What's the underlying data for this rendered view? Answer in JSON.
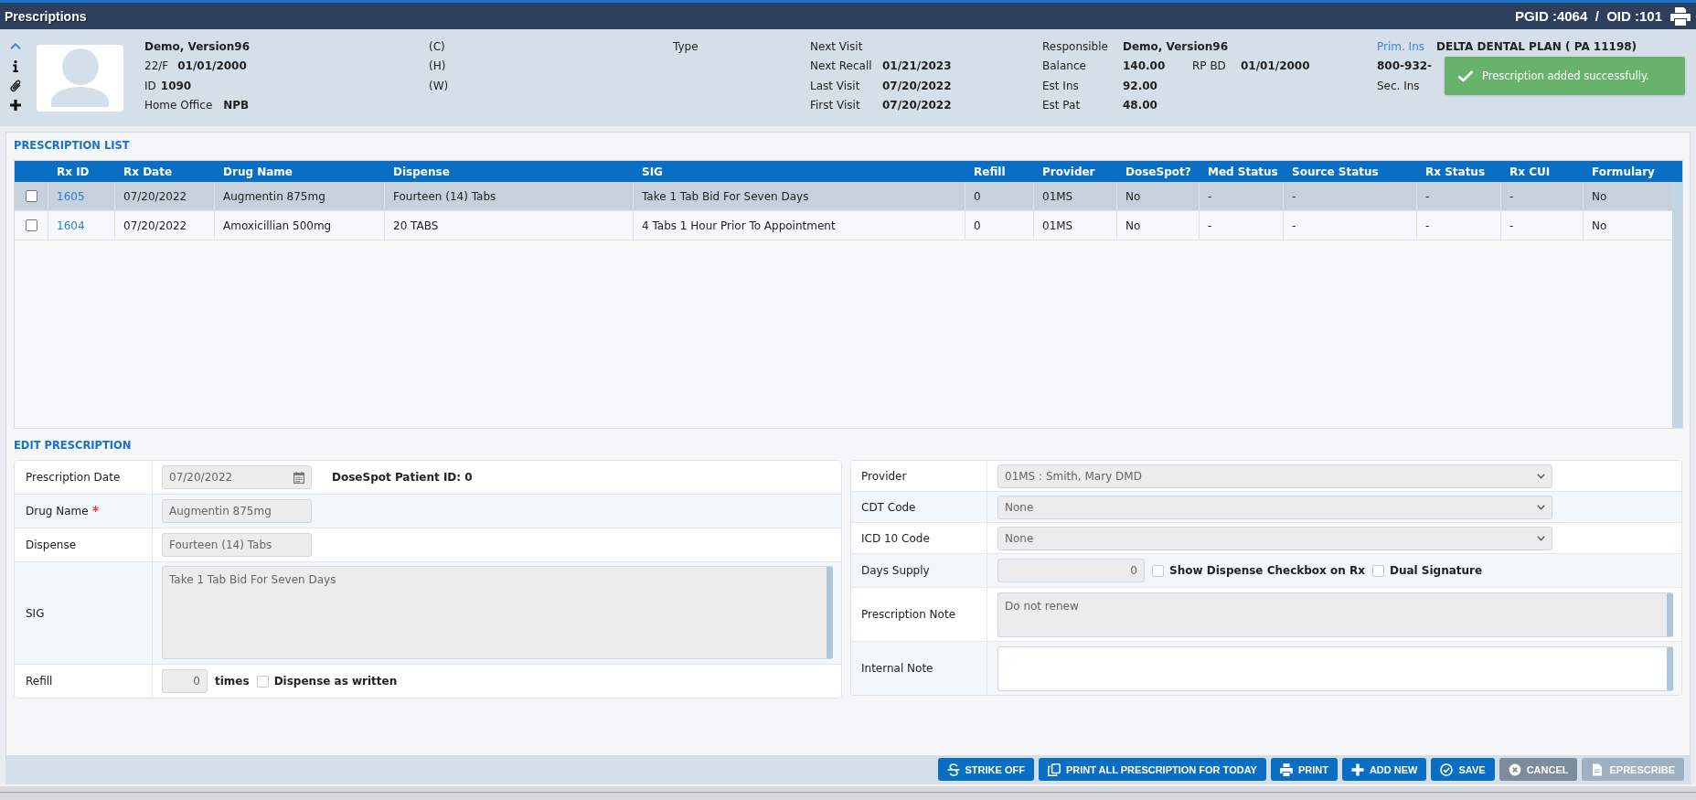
{
  "window": {
    "title": "Prescriptions",
    "ids": "PGID :4064  /  OID :101"
  },
  "patient": {
    "name": "Demo, Version96",
    "age_sex": "22/F",
    "birth_date": "01/01/2000",
    "id_label": "ID",
    "id": "1090",
    "office_label": "Home Office",
    "office": "NPB"
  },
  "phones": [
    "(C)",
    "(H)",
    "(W)"
  ],
  "type_label": "Type",
  "visits": [
    {
      "label": "Next Visit"
    },
    {
      "label": "Next Recall",
      "value": "01/21/2023"
    },
    {
      "label": "Last Visit",
      "value": "07/20/2022"
    },
    {
      "label": "First Visit",
      "value": "07/20/2022"
    }
  ],
  "account": [
    {
      "label": "Responsible",
      "value": "Demo, Version96"
    },
    {
      "label": "Balance",
      "value": "140.00",
      "extra_label": "RP BD",
      "extra_value": "01/01/2000"
    },
    {
      "label": "Est Ins",
      "value": "92.00"
    },
    {
      "label": "Est Pat",
      "value": "48.00"
    }
  ],
  "insurance": {
    "primary_label": "Prim. Ins",
    "primary_plan": "DELTA DENTAL PLAN ( PA 11198)",
    "primary_phone": "800-932-",
    "secondary_label": "Sec. Ins"
  },
  "toast": {
    "kind": "success",
    "message": "Prescription added successfully."
  },
  "prescription_list": {
    "title": "PRESCRIPTION LIST",
    "columns": [
      {
        "label": "Rx ID",
        "kind": "link"
      },
      {
        "label": "Rx Date",
        "kind": "text"
      },
      {
        "label": "Drug Name",
        "kind": "text"
      },
      {
        "label": "Dispense",
        "kind": "text"
      },
      {
        "label": "SIG",
        "kind": "text"
      },
      {
        "label": "Refill",
        "kind": "text"
      },
      {
        "label": "Provider",
        "kind": "text"
      },
      {
        "label": "DoseSpot?",
        "kind": "text"
      },
      {
        "label": "Med Status",
        "kind": "text"
      },
      {
        "label": "Source Status",
        "kind": "text"
      },
      {
        "label": "Rx Status",
        "kind": "text"
      },
      {
        "label": "Rx CUI",
        "kind": "text"
      },
      {
        "label": "Formulary",
        "kind": "text"
      }
    ],
    "rows": [
      {
        "selected": true,
        "checked": false,
        "cells": [
          "1605",
          "07/20/2022",
          "Augmentin 875mg",
          "Fourteen (14) Tabs",
          "Take 1 Tab Bid For Seven Days",
          "0",
          "01MS",
          "No",
          "-",
          "-",
          "-",
          "-",
          "No"
        ]
      },
      {
        "selected": false,
        "checked": false,
        "cells": [
          "1604",
          "07/20/2022",
          "Amoxicillian 500mg",
          "20 TABS",
          "4 Tabs 1 Hour Prior To Appointment",
          "0",
          "01MS",
          "No",
          "-",
          "-",
          "-",
          "-",
          "No"
        ]
      }
    ]
  },
  "edit_prescription": {
    "title": "EDIT PRESCRIPTION",
    "left_fields": [
      {
        "kind": "date",
        "label": "Prescription Date",
        "required": false,
        "disabled": true,
        "value": "07/20/2022",
        "note": "DoseSpot Patient ID: 0"
      },
      {
        "kind": "text",
        "label": "Drug Name",
        "required": true,
        "disabled": true,
        "value": "Augmentin 875mg"
      },
      {
        "kind": "text",
        "label": "Dispense",
        "required": false,
        "disabled": true,
        "value": "Fourteen (14) Tabs"
      },
      {
        "kind": "textarea",
        "label": "SIG",
        "required": false,
        "disabled": true,
        "value": "Take 1 Tab Bid For Seven Days"
      },
      {
        "kind": "refill",
        "label": "Refill",
        "required": false,
        "disabled": true,
        "value": "0",
        "unit": "times",
        "options": [
          {
            "label": "Dispense as written",
            "checked": false
          }
        ]
      }
    ],
    "right_fields": [
      {
        "kind": "select",
        "label": "Provider",
        "required": false,
        "disabled": true,
        "value": "01MS : Smith, Mary DMD"
      },
      {
        "kind": "select",
        "label": "CDT Code",
        "required": false,
        "disabled": true,
        "value": "None"
      },
      {
        "kind": "select",
        "label": "ICD 10 Code",
        "required": false,
        "disabled": true,
        "value": "None"
      },
      {
        "kind": "number",
        "label": "Days Supply",
        "required": false,
        "disabled": true,
        "value": "0",
        "options": [
          {
            "label": "Show Dispense Checkbox on Rx",
            "checked": false
          },
          {
            "label": "Dual Signature",
            "checked": false
          }
        ]
      },
      {
        "kind": "textarea",
        "label": "Prescription Note",
        "required": false,
        "disabled": true,
        "value": "Do not renew"
      },
      {
        "kind": "textarea",
        "label": "Internal Note",
        "required": false,
        "disabled": false
      }
    ]
  },
  "buttons": [
    {
      "label": "STRIKE OFF",
      "kind": "primary",
      "disabled": false
    },
    {
      "label": "PRINT ALL PRESCRIPTION FOR TODAY",
      "kind": "primary",
      "disabled": false
    },
    {
      "label": "PRINT",
      "kind": "primary",
      "disabled": false
    },
    {
      "label": "ADD NEW",
      "kind": "primary",
      "disabled": false
    },
    {
      "label": "SAVE",
      "kind": "primary",
      "disabled": false
    },
    {
      "label": "CANCEL",
      "kind": "secondary",
      "disabled": false
    },
    {
      "label": "EPRESCRIBE",
      "kind": "primary",
      "disabled": true
    }
  ]
}
